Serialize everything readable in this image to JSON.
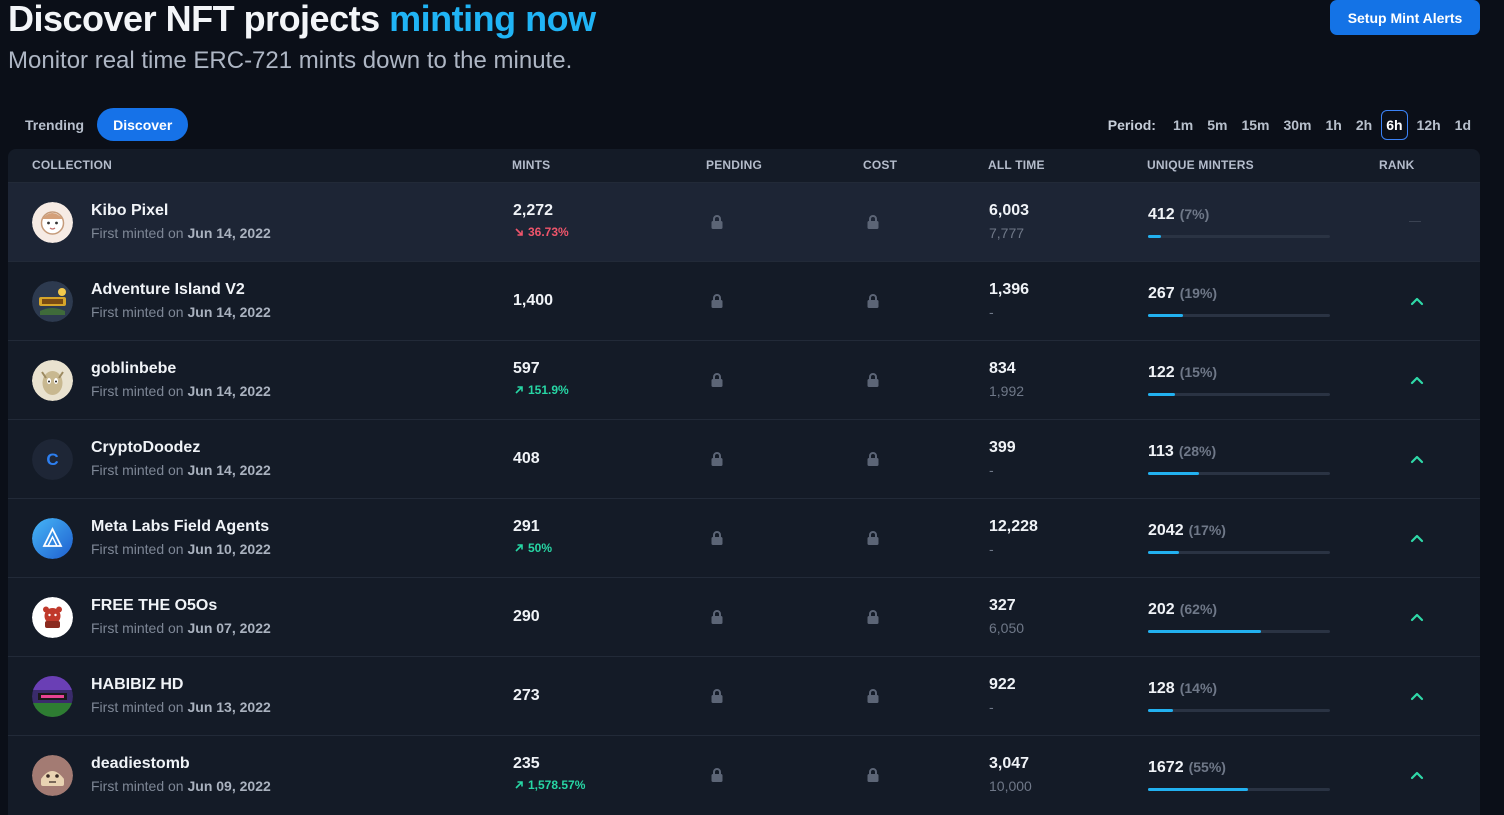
{
  "header": {
    "title_main": "Discover NFT projects ",
    "title_accent": "minting now",
    "subtitle": "Monitor real time ERC-721 mints down to the minute.",
    "alert_button": "Setup Mint Alerts"
  },
  "tabs": [
    {
      "label": "Trending",
      "active": false
    },
    {
      "label": "Discover",
      "active": true
    }
  ],
  "period": {
    "label": "Period:",
    "options": [
      "1m",
      "5m",
      "15m",
      "30m",
      "1h",
      "2h",
      "6h",
      "12h",
      "1d"
    ],
    "selected": "6h"
  },
  "columns": {
    "collection": "COLLECTION",
    "mints": "MINTS",
    "pending": "PENDING",
    "cost": "COST",
    "all_time": "ALL TIME",
    "unique_minters": "UNIQUE MINTERS",
    "rank": "RANK"
  },
  "first_minted_prefix": "First minted on",
  "rows": [
    {
      "name": "Kibo Pixel",
      "date": "Jun 14, 2022",
      "mints": "2,272",
      "change": "36.73%",
      "change_dir": "down",
      "all_time": "6,003",
      "all_time_sub": "7,777",
      "unique": "412",
      "unique_pct": "(7%)",
      "bar_fraction": 0.07,
      "rank": "none",
      "avatar": "kibo"
    },
    {
      "name": "Adventure Island V2",
      "date": "Jun 14, 2022",
      "mints": "1,400",
      "change": "",
      "change_dir": "",
      "all_time": "1,396",
      "all_time_sub": "-",
      "unique": "267",
      "unique_pct": "(19%)",
      "bar_fraction": 0.19,
      "rank": "up",
      "avatar": "island"
    },
    {
      "name": "goblinbebe",
      "date": "Jun 14, 2022",
      "mints": "597",
      "change": "151.9%",
      "change_dir": "up",
      "all_time": "834",
      "all_time_sub": "1,992",
      "unique": "122",
      "unique_pct": "(15%)",
      "bar_fraction": 0.15,
      "rank": "up",
      "avatar": "goblin"
    },
    {
      "name": "CryptoDoodez",
      "date": "Jun 14, 2022",
      "mints": "408",
      "change": "",
      "change_dir": "",
      "all_time": "399",
      "all_time_sub": "-",
      "unique": "113",
      "unique_pct": "(28%)",
      "bar_fraction": 0.28,
      "rank": "up",
      "avatar": "letter",
      "avatar_letter": "C"
    },
    {
      "name": "Meta Labs Field Agents",
      "date": "Jun 10, 2022",
      "mints": "291",
      "change": "50%",
      "change_dir": "up",
      "all_time": "12,228",
      "all_time_sub": "-",
      "unique": "2042",
      "unique_pct": "(17%)",
      "bar_fraction": 0.17,
      "rank": "up",
      "avatar": "meta"
    },
    {
      "name": "FREE THE O5Os",
      "date": "Jun 07, 2022",
      "mints": "290",
      "change": "",
      "change_dir": "",
      "all_time": "327",
      "all_time_sub": "6,050",
      "unique": "202",
      "unique_pct": "(62%)",
      "bar_fraction": 0.62,
      "rank": "up",
      "avatar": "free"
    },
    {
      "name": "HABIBIZ HD",
      "date": "Jun 13, 2022",
      "mints": "273",
      "change": "",
      "change_dir": "",
      "all_time": "922",
      "all_time_sub": "-",
      "unique": "128",
      "unique_pct": "(14%)",
      "bar_fraction": 0.14,
      "rank": "up",
      "avatar": "habibiz"
    },
    {
      "name": "deadiestomb",
      "date": "Jun 09, 2022",
      "mints": "235",
      "change": "1,578.57%",
      "change_dir": "up",
      "all_time": "3,047",
      "all_time_sub": "10,000",
      "unique": "1672",
      "unique_pct": "(55%)",
      "bar_fraction": 0.55,
      "rank": "up",
      "avatar": "deadie"
    }
  ]
}
